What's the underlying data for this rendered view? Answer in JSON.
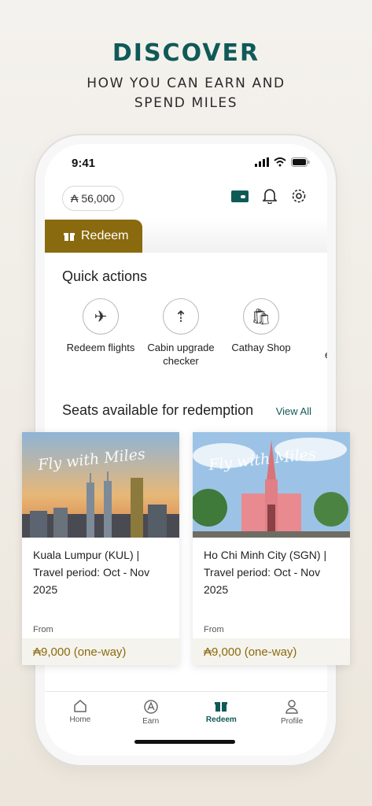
{
  "hero": {
    "title": "DISCOVER",
    "subtitle_line1": "HOW YOU CAN EARN AND",
    "subtitle_line2": "SPEND MILES"
  },
  "status_bar": {
    "time": "9:41"
  },
  "header": {
    "miles_balance": "56,000",
    "icons": [
      "membership-card-icon",
      "bell-icon",
      "gear-icon"
    ]
  },
  "tab": {
    "label": "Redeem"
  },
  "quick_actions": {
    "title": "Quick actions",
    "items": [
      {
        "icon": "plane-icon",
        "label": "Redeem flights"
      },
      {
        "icon": "seat-upgrade-icon",
        "label": "Cabin upgrade checker"
      },
      {
        "icon": "shopping-bag-icon",
        "label": "Cathay Shop"
      },
      {
        "icon": "more-icon",
        "label": "ex"
      }
    ]
  },
  "seats": {
    "title": "Seats available for redemption",
    "view_all": "View All",
    "cards": [
      {
        "image_script": "Fly with Miles",
        "title": "Kuala Lumpur (KUL) | Travel period: Oct - Nov 2025",
        "from_label": "From",
        "price": "9,000 (one-way)"
      },
      {
        "image_script": "Fly with Miles",
        "title": "Ho Chi Minh City (SGN) | Travel period: Oct - Nov 2025",
        "from_label": "From",
        "price": "9,000 (one-way)"
      }
    ]
  },
  "bottom_nav": {
    "items": [
      {
        "label": "Home",
        "icon": "home-icon"
      },
      {
        "label": "Earn",
        "icon": "asia-miles-icon"
      },
      {
        "label": "Redeem",
        "icon": "gift-icon",
        "active": true
      },
      {
        "label": "Profile",
        "icon": "profile-icon"
      }
    ]
  },
  "colors": {
    "brand_green": "#0f5a57",
    "redeem_gold": "#8a6a0e"
  }
}
